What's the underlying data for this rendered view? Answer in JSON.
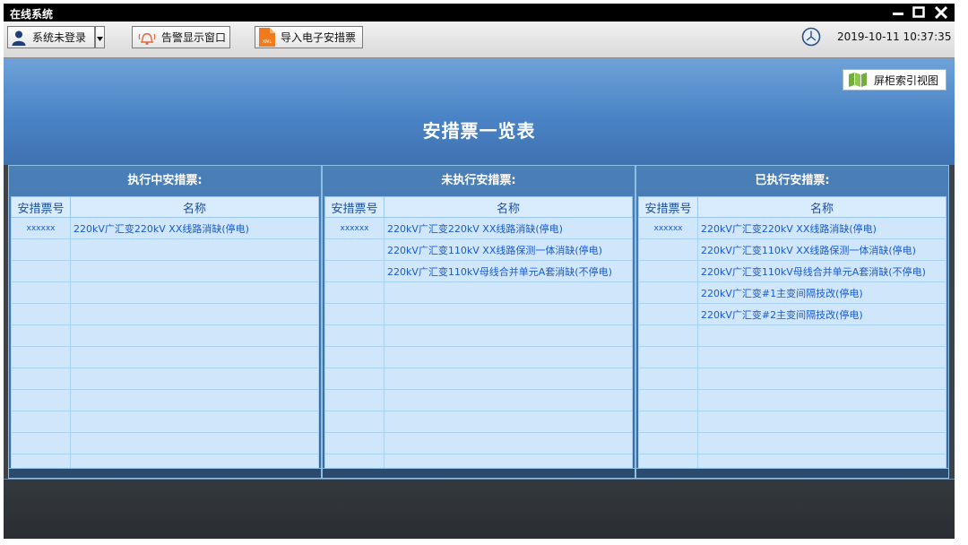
{
  "window": {
    "title": "在线系统"
  },
  "toolbar": {
    "user_label": "系统未登录",
    "alarm_label": "告警显示窗口",
    "import_label": "导入电子安措票",
    "import_badge": "XML"
  },
  "datetime": "2019-10-11 10:37:35",
  "index_view_label": "屏柜索引视图",
  "page_title": "安措票一览表",
  "columns": {
    "no": "安措票号",
    "name": "名称"
  },
  "panels": [
    {
      "title": "执行中安措票:",
      "rows": [
        {
          "no": "xxxxxx",
          "name": "220kV广汇变220kV XX线路消缺(停电)"
        },
        {
          "no": "",
          "name": ""
        },
        {
          "no": "",
          "name": ""
        },
        {
          "no": "",
          "name": ""
        },
        {
          "no": "",
          "name": ""
        },
        {
          "no": "",
          "name": ""
        },
        {
          "no": "",
          "name": ""
        },
        {
          "no": "",
          "name": ""
        },
        {
          "no": "",
          "name": ""
        },
        {
          "no": "",
          "name": ""
        },
        {
          "no": "",
          "name": ""
        },
        {
          "no": "",
          "name": ""
        }
      ]
    },
    {
      "title": "未执行安措票:",
      "rows": [
        {
          "no": "xxxxxx",
          "name": "220kV广汇变220kV XX线路消缺(停电)"
        },
        {
          "no": "",
          "name": "220kV广汇变110kV XX线路保测一体消缺(停电)"
        },
        {
          "no": "",
          "name": "220kV广汇变110kV母线合并单元A套消缺(不停电)"
        },
        {
          "no": "",
          "name": ""
        },
        {
          "no": "",
          "name": ""
        },
        {
          "no": "",
          "name": ""
        },
        {
          "no": "",
          "name": ""
        },
        {
          "no": "",
          "name": ""
        },
        {
          "no": "",
          "name": ""
        },
        {
          "no": "",
          "name": ""
        },
        {
          "no": "",
          "name": ""
        },
        {
          "no": "",
          "name": ""
        }
      ]
    },
    {
      "title": "已执行安措票:",
      "rows": [
        {
          "no": "xxxxxx",
          "name": "220kV广汇变220kV XX线路消缺(停电)"
        },
        {
          "no": "",
          "name": "220kV广汇变110kV XX线路保测一体消缺(停电)"
        },
        {
          "no": "",
          "name": "220kV广汇变110kV母线合并单元A套消缺(不停电)"
        },
        {
          "no": "",
          "name": "220kV广汇变#1主变间隔技改(停电)"
        },
        {
          "no": "",
          "name": "220kV广汇变#2主变间隔技改(停电)"
        },
        {
          "no": "",
          "name": ""
        },
        {
          "no": "",
          "name": ""
        },
        {
          "no": "",
          "name": ""
        },
        {
          "no": "",
          "name": ""
        },
        {
          "no": "",
          "name": ""
        },
        {
          "no": "",
          "name": ""
        },
        {
          "no": "",
          "name": ""
        }
      ]
    }
  ]
}
